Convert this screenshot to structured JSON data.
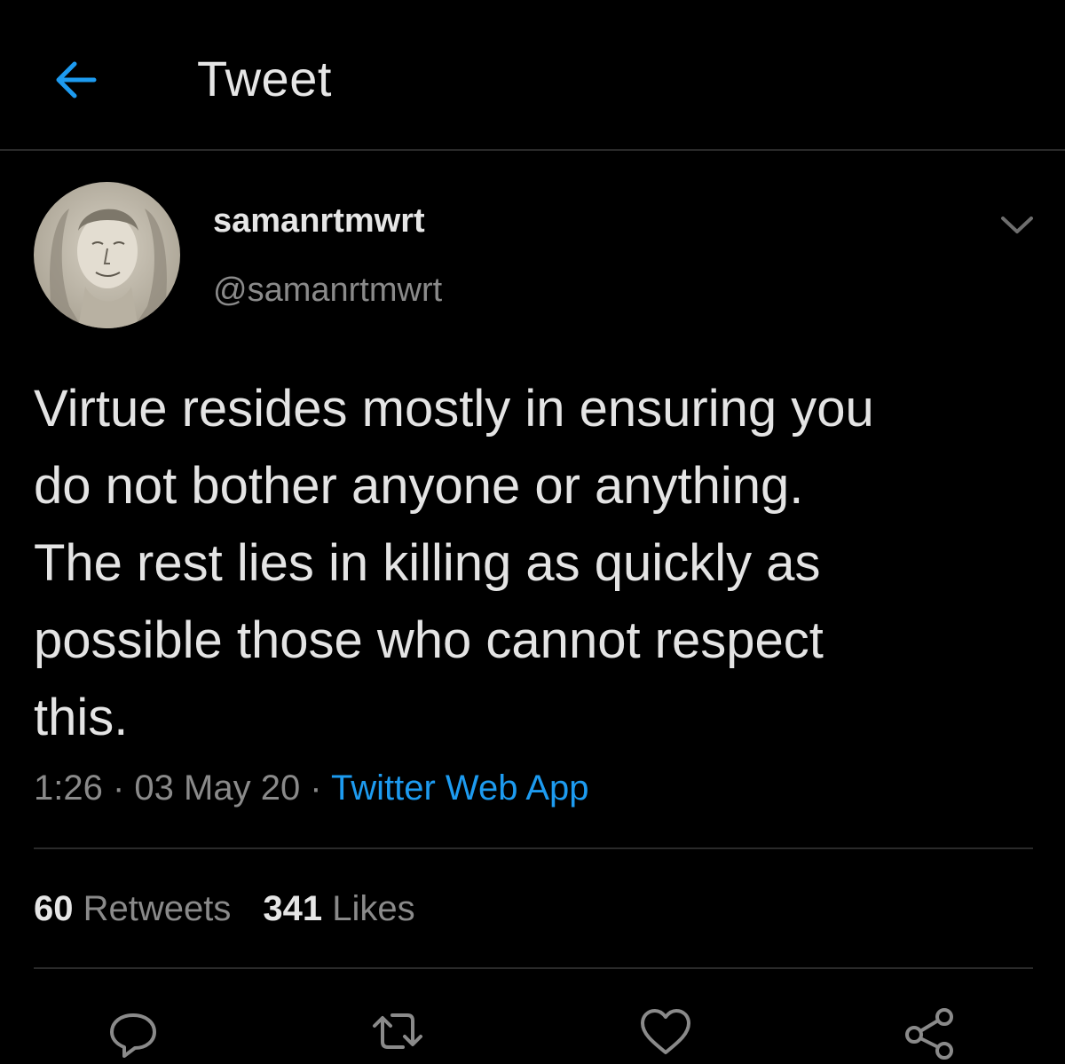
{
  "header": {
    "title": "Tweet",
    "back_icon": "arrow-left-icon",
    "accent_color": "#1d9bf0"
  },
  "tweet": {
    "display_name": "samanrtmwrt",
    "handle": "@samanrtmwrt",
    "text_lines": [
      "Virtue resides mostly in ensuring you",
      "do not bother anyone or anything.",
      "The rest lies in killing as quickly as",
      "possible those who cannot respect",
      "this."
    ],
    "time": "1:26",
    "separator": " · ",
    "date": "03 May 20",
    "source": "Twitter Web App"
  },
  "stats": {
    "retweets_count": "60",
    "retweets_label": "Retweets",
    "likes_count": "341",
    "likes_label": "Likes"
  },
  "actions": [
    {
      "icon": "reply-icon"
    },
    {
      "icon": "retweet-icon"
    },
    {
      "icon": "like-icon"
    },
    {
      "icon": "share-icon"
    }
  ]
}
